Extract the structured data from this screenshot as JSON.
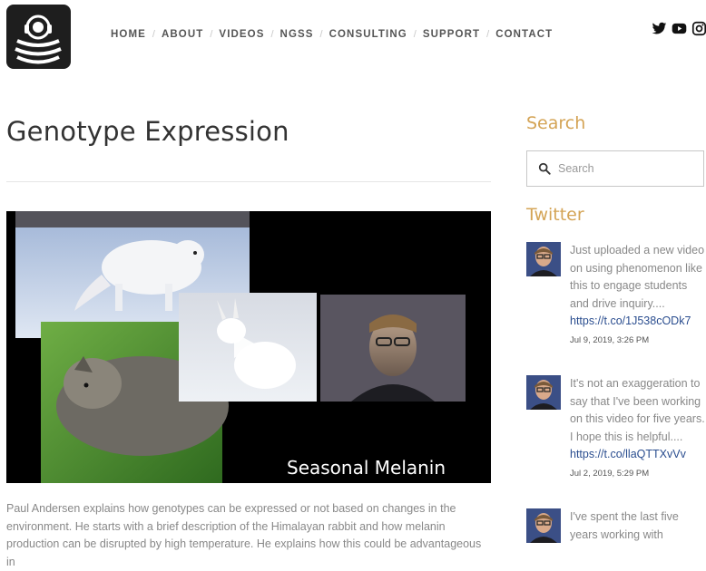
{
  "header": {
    "logo_icon": "sound-waves-logo-icon",
    "nav_items": [
      "HOME",
      "ABOUT",
      "VIDEOS",
      "NGSS",
      "CONSULTING",
      "SUPPORT",
      "CONTACT"
    ],
    "social_icons": [
      "twitter-icon",
      "youtube-icon",
      "instagram-icon"
    ]
  },
  "main": {
    "title": "Genotype Expression",
    "video": {
      "caption": "Seasonal Melanin",
      "play_icon": "play-icon"
    },
    "description": "Paul Andersen explains how genotypes can be expressed or not based on changes in the environment. He starts with a brief description of the Himalayan rabbit and how melanin production can be disrupted by high temperature. He explains how this could be advantageous in"
  },
  "sidebar": {
    "search_heading": "Search",
    "search_placeholder": "Search",
    "twitter_heading": "Twitter",
    "tweets": [
      {
        "text": "Just uploaded a new video on using phenomenon like this to engage students and drive inquiry....",
        "link": "https://t.co/1J538cODk7",
        "date": "Jul 9, 2019, 3:26 PM"
      },
      {
        "text": "It's not an exaggeration to say that I've been working on this video for five years. I hope this is helpful....",
        "link": "https://t.co/llaQTTXvVv",
        "date": "Jul 2, 2019, 5:29 PM"
      },
      {
        "text": "I've spent the last five years working with"
      }
    ]
  },
  "colors": {
    "accent_gold": "#d4a456",
    "link_blue": "#2a4d8f",
    "muted_text": "#888888"
  }
}
